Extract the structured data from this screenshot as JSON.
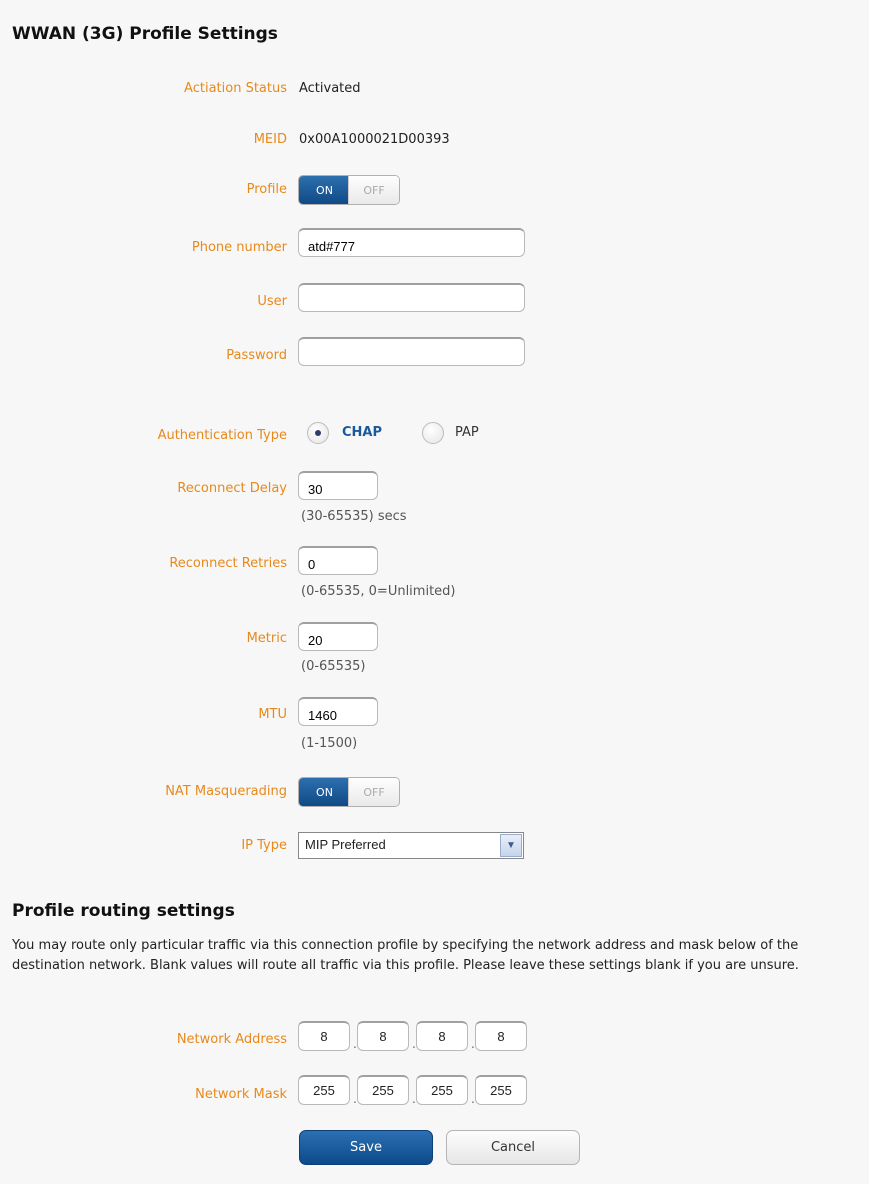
{
  "header": {
    "title": "WWAN (3G) Profile Settings"
  },
  "fields": {
    "activation_status": {
      "label": "Actiation Status",
      "value": "Activated"
    },
    "meid": {
      "label": "MEID",
      "value": "0x00A1000021D00393"
    },
    "profile": {
      "label": "Profile",
      "on_label": "ON",
      "off_label": "OFF",
      "state": "ON"
    },
    "phone_number": {
      "label": "Phone number",
      "value": "atd#777"
    },
    "user": {
      "label": "User",
      "value": ""
    },
    "password": {
      "label": "Password",
      "value": ""
    },
    "auth_type": {
      "label": "Authentication Type",
      "options": [
        "CHAP",
        "PAP"
      ],
      "selected": "CHAP"
    },
    "reconnect_delay": {
      "label": "Reconnect Delay",
      "value": "30",
      "hint": "(30-65535) secs"
    },
    "reconnect_retries": {
      "label": "Reconnect Retries",
      "value": "0",
      "hint": "(0-65535, 0=Unlimited)"
    },
    "metric": {
      "label": "Metric",
      "value": "20",
      "hint": "(0-65535)"
    },
    "mtu": {
      "label": "MTU",
      "value": "1460",
      "hint": "(1-1500)"
    },
    "nat": {
      "label": "NAT Masquerading",
      "on_label": "ON",
      "off_label": "OFF",
      "state": "ON"
    },
    "ip_type": {
      "label": "IP Type",
      "value": "MIP Preferred"
    }
  },
  "routing": {
    "title": "Profile routing settings",
    "description": "You may route only particular traffic via this connection profile by specifying the network address and mask below of the destination network. Blank values will route all traffic via this profile. Please leave these settings blank if you are unsure.",
    "network_address": {
      "label": "Network Address",
      "octets": [
        "8",
        "8",
        "8",
        "8"
      ]
    },
    "network_mask": {
      "label": "Network Mask",
      "octets": [
        "255",
        "255",
        "255",
        "255"
      ]
    }
  },
  "buttons": {
    "save": "Save",
    "cancel": "Cancel"
  },
  "colors": {
    "label": "#e8891b",
    "accent": "#0f4a86",
    "selected_radio_text": "#1a5a9c"
  }
}
